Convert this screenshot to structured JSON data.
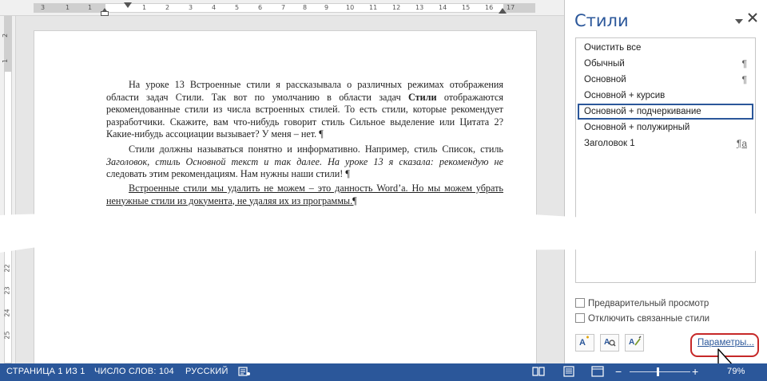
{
  "ruler": {
    "h_ticks": [
      "3",
      "1",
      "1",
      "1",
      "2",
      "3",
      "4",
      "5",
      "6",
      "7",
      "8",
      "9",
      "10",
      "11",
      "12",
      "13",
      "14",
      "15",
      "16",
      "17"
    ],
    "v_ticks": [
      "2",
      "1",
      "22",
      "23",
      "24",
      "25"
    ]
  },
  "document": {
    "paragraph1": {
      "a": "На уроке 13 Встроенные стили я рассказывала о различных режимах отображения области задач Стили. Так вот по умолчанию в области задач ",
      "bold": "Стили",
      "b": " отображаются рекомендованные стили из числа встроенных стилей. То есть стили, которые рекомендует разработчики. Скажите, вам что-нибудь говорит стиль Сильное выделение или Цитата 2? Какие-нибудь ассоциации вызывает? У меня – нет. ¶"
    },
    "paragraph2": {
      "a": "Стили должны называться понятно и информативно. Например, стиль Список, стиль ",
      "italic": "Заголовок, стиль Основной текст и так далее. На уроке 13 я сказала: рекомендую не",
      "b": " следовать этим рекомендациям. Нам нужны наши стили! ¶"
    },
    "paragraph3": "Встроенные стили мы удалить не можем – это данность Word’а. Но мы можем убрать ненужные стили из документа, не удаляя их из программы.¶"
  },
  "styles_pane": {
    "title": "Стили",
    "dropdown_icon": "chevron-down-icon",
    "close_icon": "close-icon",
    "items": [
      {
        "label": "Очистить все",
        "mark": ""
      },
      {
        "label": "Обычный",
        "mark": "¶"
      },
      {
        "label": "Основной",
        "mark": "¶"
      },
      {
        "label": "Основной + курсив",
        "mark": ""
      },
      {
        "label": "Основной + подчеркивание",
        "mark": ""
      },
      {
        "label": "Основной + полужирный",
        "mark": ""
      },
      {
        "label": "Заголовок 1",
        "mark": "¶a"
      }
    ],
    "selected_index": 4,
    "preview_label": "Предварительный просмотр",
    "preview_checked": false,
    "disable_linked_label": "Отключить связанные стили",
    "disable_linked_checked": false,
    "new_style_icon": "new-style-icon",
    "style_inspector_icon": "style-inspector-icon",
    "manage_styles_icon": "manage-styles-icon",
    "options_link": "Параметры..."
  },
  "status_bar": {
    "page": "СТРАНИЦА 1 ИЗ 1",
    "words": "ЧИСЛО СЛОВ: 104",
    "language": "РУССКИЙ",
    "zoom_minus": "−",
    "zoom_plus": "+",
    "zoom": "79%"
  },
  "colors": {
    "accent": "#2b579a",
    "highlight_ring": "#c62828"
  }
}
